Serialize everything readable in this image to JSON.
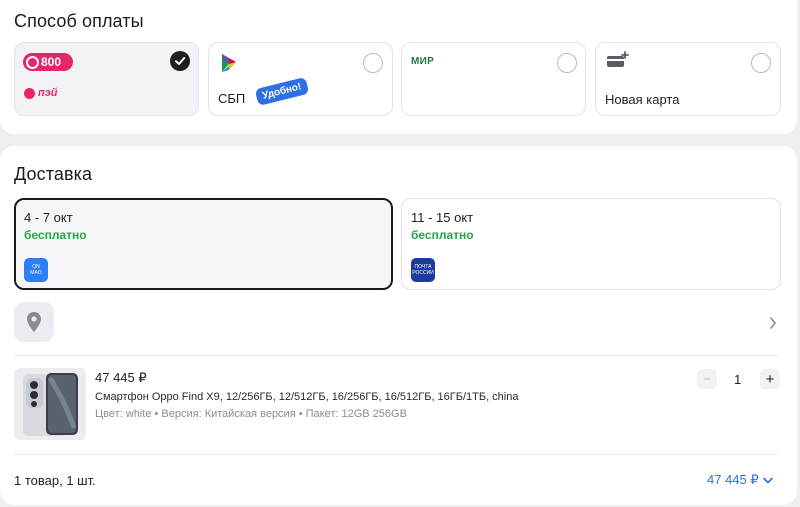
{
  "payment": {
    "title": "Способ оплаты",
    "methods": [
      {
        "brand_top": "800",
        "brand_bottom": "пэй",
        "selected": true
      },
      {
        "label": "СБП",
        "badge": "Удобно!",
        "selected": false
      },
      {
        "brand": "МИР",
        "selected": false
      },
      {
        "label": "Новая карта",
        "selected": false
      }
    ]
  },
  "delivery": {
    "title": "Доставка",
    "options": [
      {
        "dates": "4 - 7 окт",
        "price": "бесплатно",
        "carrier_logo": "ON\nMAO",
        "logo_color": "#2c7ff5",
        "selected": true
      },
      {
        "dates": "11 - 15 окт",
        "price": "бесплатно",
        "carrier_logo": "ПОЧТА\nРОССИИ",
        "logo_color": "#1d3a9f",
        "selected": false
      }
    ]
  },
  "product": {
    "price": "47 445 ₽",
    "name": "Смартфон Oppo Find X9, 12/256ГБ, 12/512ГБ, 16/256ГБ, 16/512ГБ, 16ГБ/1ТБ, china",
    "attributes": "Цвет: white • Версия: Китайская версия • Пакет: 12GB 256GB",
    "quantity": "1",
    "minus": "−",
    "plus": "+"
  },
  "summary": {
    "count": "1 товар, 1 шт.",
    "total": "47 445 ₽"
  },
  "colors": {
    "accent": "#2f6fe6",
    "green": "#26a64a",
    "sbp": "#2f6fe6",
    "pay800": "#e6266b",
    "mir": "#1f7a4b"
  }
}
